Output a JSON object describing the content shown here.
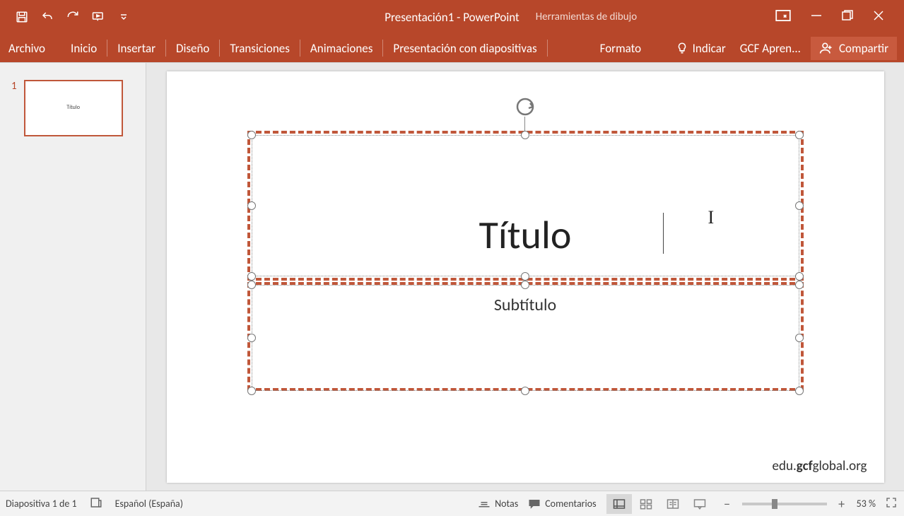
{
  "app": {
    "title": "Presentación1 - PowerPoint",
    "contextualTab": "Herramientas de dibujo"
  },
  "ribbon": {
    "tabs": [
      "Archivo",
      "Inicio",
      "Insertar",
      "Diseño",
      "Transiciones",
      "Animaciones",
      "Presentación con diapositivas"
    ],
    "formatTab": "Formato",
    "tellMe": "Indicar",
    "account": "GCF Apren...",
    "share": "Compartir"
  },
  "thumbnails": {
    "items": [
      {
        "num": "1",
        "title": "Título"
      }
    ]
  },
  "slide": {
    "title": "Título",
    "subtitle": "Subtítulo",
    "watermark_pre": "edu.",
    "watermark_bold": "gcf",
    "watermark_post": "global.org"
  },
  "status": {
    "slideInfo": "Diapositiva 1 de 1",
    "language": "Español (España)",
    "notes": "Notas",
    "comments": "Comentarios",
    "zoom": "53 %"
  }
}
